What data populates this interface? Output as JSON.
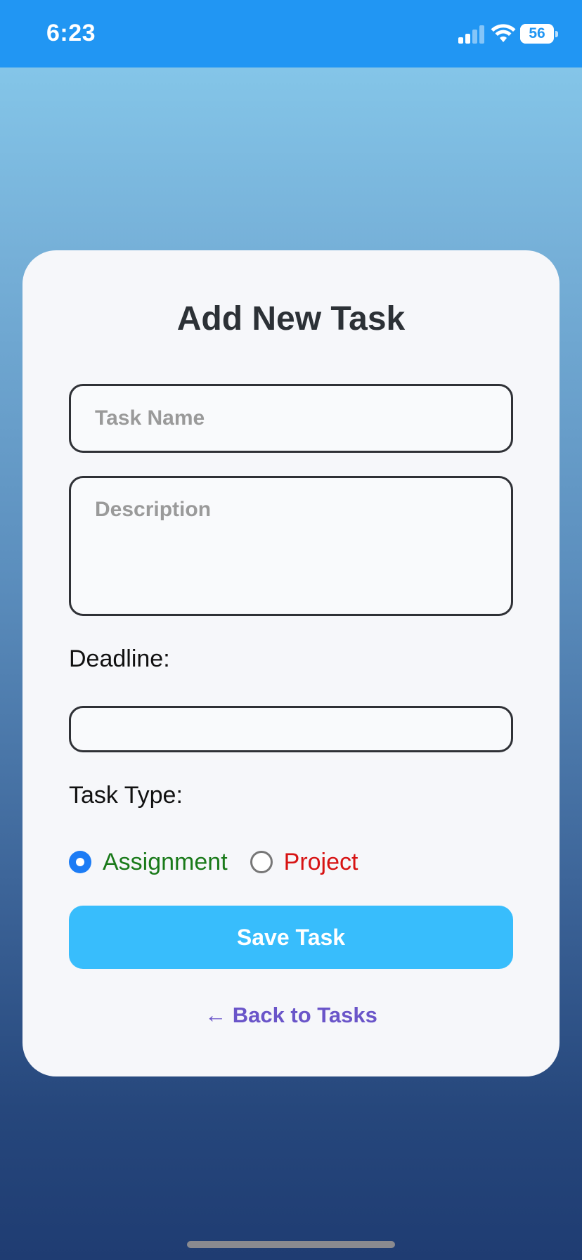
{
  "status_bar": {
    "time": "6:23",
    "battery_level": "56"
  },
  "form": {
    "title": "Add New Task",
    "task_name_placeholder": "Task Name",
    "description_placeholder": "Description",
    "deadline_label": "Deadline:",
    "deadline_value": "",
    "task_type_label": "Task Type:",
    "task_types": [
      {
        "label": "Assignment",
        "selected": true,
        "color": "#1a7a1a"
      },
      {
        "label": "Project",
        "selected": false,
        "color": "#d71313"
      }
    ],
    "save_label": "Save Task",
    "back_label": "← Back to Tasks"
  },
  "colors": {
    "status_bar": "#2196f3",
    "save_button": "#38bdfc",
    "back_link": "#6a55c9",
    "radio_checked": "#1c7cf5"
  }
}
